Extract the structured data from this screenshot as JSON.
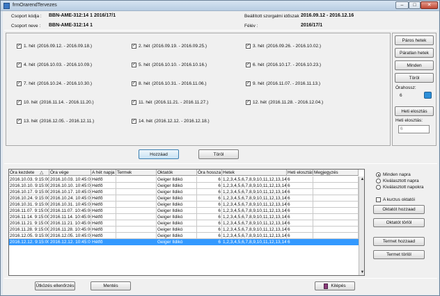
{
  "window": {
    "title": "frmOrarendTervezes",
    "minimize": "–",
    "maximize": "□",
    "close": "✕"
  },
  "header": {
    "group_code_label": "Csoport kódja :",
    "group_code": "BBN-AME-312:14 1 2016/17/1",
    "group_name_label": "Csoport neve :",
    "group_name": "BBN-AME-312:14 1",
    "period_label": "Beállított szorgalmi időszak",
    "period": "2016.09.12 - 2016.12.16",
    "semester_label": "Félév :",
    "semester": "2016/17/1"
  },
  "weeks": [
    {
      "label": "1. hét",
      "range": "(2016.09.12. - 2016.09.18.)",
      "checked": true
    },
    {
      "label": "2. hét",
      "range": "(2016.09.19. - 2016.09.25.)",
      "checked": true
    },
    {
      "label": "3. hét",
      "range": "(2016.09.26. - 2016.10.02.)",
      "checked": true
    },
    {
      "label": "4. hét",
      "range": "(2016.10.03. - 2016.10.09.)",
      "checked": true
    },
    {
      "label": "5. hét",
      "range": "(2016.10.10. - 2016.10.16.)",
      "checked": true
    },
    {
      "label": "6. hét",
      "range": "(2016.10.17. - 2016.10.23.)",
      "checked": true
    },
    {
      "label": "7. hét",
      "range": "(2016.10.24. - 2016.10.30.)",
      "checked": true
    },
    {
      "label": "8. hét",
      "range": "(2016.10.31. - 2016.11.06.)",
      "checked": true
    },
    {
      "label": "9. hét",
      "range": "(2016.11.07. - 2016.11.13.)",
      "checked": true
    },
    {
      "label": "10. hét",
      "range": "(2016.11.14. - 2016.11.20.)",
      "checked": true
    },
    {
      "label": "11. hét",
      "range": "(2016.11.21. - 2016.11.27.)",
      "checked": true
    },
    {
      "label": "12. hét",
      "range": "(2016.11.28. - 2016.12.04.)",
      "checked": true
    },
    {
      "label": "13. hét",
      "range": "(2016.12.05. - 2016.12.11.)",
      "checked": true
    },
    {
      "label": "14. hét",
      "range": "(2016.12.12. - 2016.12.18.)",
      "checked": true
    }
  ],
  "week_buttons": {
    "even": "Páros hetek",
    "odd": "Páratlan hetek",
    "all": "Minden",
    "clear": "Töröl"
  },
  "hours": {
    "label": "Órahossz:",
    "value": "6"
  },
  "weekly": {
    "button": "Heti elosztás",
    "label": "Heti elosztás:",
    "placeholder": "6"
  },
  "mid_buttons": {
    "add": "Hozzáad",
    "delete": "Töröl"
  },
  "table": {
    "columns": [
      "Óra kezdete",
      "Óra vége",
      "A hét napja",
      "Termek",
      "Oktatók",
      "Óra hossza",
      "Hetek",
      "Heti elosztás",
      "Megjegyzés"
    ],
    "sort_icon": "△",
    "rows": [
      [
        "2016.10.03. 9:15:00",
        "2016.10.03. 10:45:00",
        "Hétfő",
        "",
        "Geiger Ildikó",
        "6",
        "1,2,3,4,5,6,7,8,9,10,11,12,13,14",
        "6",
        ""
      ],
      [
        "2016.10.10. 9:15:00",
        "2016.10.10. 10:45:00",
        "Hétfő",
        "",
        "Geiger Ildikó",
        "6",
        "1,2,3,4,5,6,7,8,9,10,11,12,13,14",
        "6",
        ""
      ],
      [
        "2016.10.17. 9:15:00",
        "2016.10.17. 10:45:00",
        "Hétfő",
        "",
        "Geiger Ildikó",
        "6",
        "1,2,3,4,5,6,7,8,9,10,11,12,13,14",
        "6",
        ""
      ],
      [
        "2016.10.24. 9:15:00",
        "2016.10.24. 10:45:00",
        "Hétfő",
        "",
        "Geiger Ildikó",
        "6",
        "1,2,3,4,5,6,7,8,9,10,11,12,13,14",
        "6",
        ""
      ],
      [
        "2016.10.31. 9:15:00",
        "2016.10.31. 10:45:00",
        "Hétfő",
        "",
        "Geiger Ildikó",
        "6",
        "1,2,3,4,5,6,7,8,9,10,11,12,13,14",
        "6",
        ""
      ],
      [
        "2016.11.07. 9:15:00",
        "2016.11.07. 10:45:00",
        "Hétfő",
        "",
        "Geiger Ildikó",
        "6",
        "1,2,3,4,5,6,7,8,9,10,11,12,13,14",
        "6",
        ""
      ],
      [
        "2016.11.14. 9:15:00",
        "2016.11.14. 10:45:00",
        "Hétfő",
        "",
        "Geiger Ildikó",
        "6",
        "1,2,3,4,5,6,7,8,9,10,11,12,13,14",
        "6",
        ""
      ],
      [
        "2016.11.21. 9:15:00",
        "2016.11.21. 10:45:00",
        "Hétfő",
        "",
        "Geiger Ildikó",
        "6",
        "1,2,3,4,5,6,7,8,9,10,11,12,13,14",
        "6",
        ""
      ],
      [
        "2016.11.28. 9:15:00",
        "2016.11.28. 10:45:00",
        "Hétfő",
        "",
        "Geiger Ildikó",
        "6",
        "1,2,3,4,5,6,7,8,9,10,11,12,13,14",
        "6",
        ""
      ],
      [
        "2016.12.05. 9:15:00",
        "2016.12.05. 10:45:00",
        "Hétfő",
        "",
        "Geiger Ildikó",
        "6",
        "1,2,3,4,5,6,7,8,9,10,11,12,13,14",
        "6",
        ""
      ],
      [
        "2016.12.12. 9:15:00",
        "2016.12.12. 10:45:00",
        "Hétfő",
        "",
        "Geiger Ildikó",
        "6",
        "1,2,3,4,5,6,7,8,9,10,11,12,13,14",
        "6",
        ""
      ]
    ],
    "selected_row": 10
  },
  "side_panel": {
    "radio_all": "Minden napra",
    "radio_day": "Kiválasztott napra",
    "radio_days": "Kiválasztott napokra",
    "course_teacher": "A kurzus oktatói",
    "add_teacher": "Oktatót hozzaad",
    "delete_teacher": "Oktatót törlöl",
    "add_room": "Termet hozzaad",
    "delete_room": "Termet törlöl"
  },
  "footer": {
    "conflict_check": "Ütközés ellenőrzés",
    "save": "Mentés",
    "exit": "Kilépés"
  }
}
